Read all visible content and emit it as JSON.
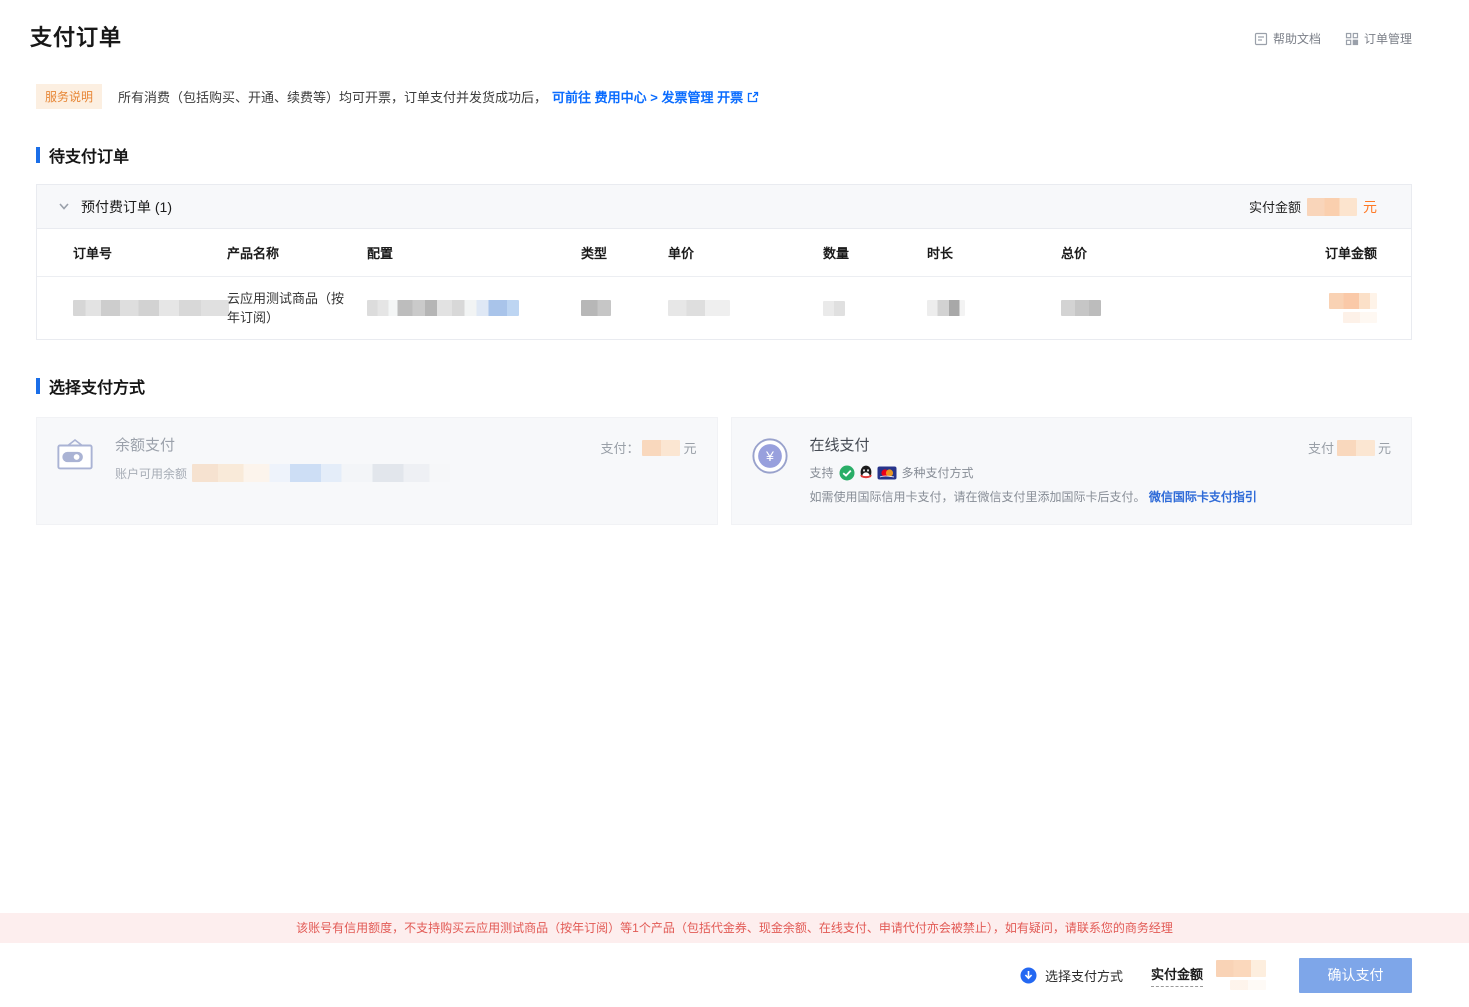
{
  "palette": {
    "accent_blue": "#1a6ee8",
    "link_blue": "#0a6cff",
    "amount_orange": "#ff7a26",
    "tag_text_orange": "#e78635",
    "tag_bg_orange": "#fcefe1",
    "warning_red": "#e25a55",
    "warning_bg": "#fdeeee",
    "confirm_button_blue": "#7ea6e9",
    "panel_header_bg": "#f7f8fa"
  },
  "header": {
    "title": "支付订单",
    "links": [
      {
        "label": "帮助文档",
        "icon": "document-icon"
      },
      {
        "label": "订单管理",
        "icon": "grid-icon"
      }
    ]
  },
  "notice": {
    "tag": "服务说明",
    "text": "所有消费（包括购买、开通、续费等）均可开票，订单支付并发货成功后，",
    "link": "可前往 费用中心 > 发票管理 开票"
  },
  "pending": {
    "section_title": "待支付订单",
    "group_title": "预付费订单 (1)",
    "paid_label": "实付金额",
    "unit": "元",
    "columns": [
      "订单号",
      "产品名称",
      "配置",
      "类型",
      "单价",
      "数量",
      "时长",
      "总价",
      "订单金额"
    ],
    "row": {
      "product_name": "云应用测试商品（按年订阅）"
    }
  },
  "payment": {
    "section_title": "选择支付方式",
    "balance": {
      "title": "余额支付",
      "available_label": "账户可用余额",
      "pay_label": "支付：",
      "unit": "元"
    },
    "online": {
      "title": "在线支付",
      "support_prefix": "支持",
      "support_suffix": "多种支付方式",
      "note": "如需使用国际信用卡支付，请在微信支付里添加国际卡后支付。",
      "guide_link": "微信国际卡支付指引",
      "pay_label": "支付",
      "unit": "元"
    }
  },
  "warning": "该账号有信用额度，不支持购买云应用测试商品（按年订阅）等1个产品（包括代金券、现金余额、在线支付、申请代付亦会被禁止），如有疑问，请联系您的商务经理",
  "footer": {
    "choose_label": "选择支付方式",
    "amount_label": "实付金额",
    "confirm_label": "确认支付"
  },
  "icons": {
    "yuan_symbol": "¥"
  }
}
